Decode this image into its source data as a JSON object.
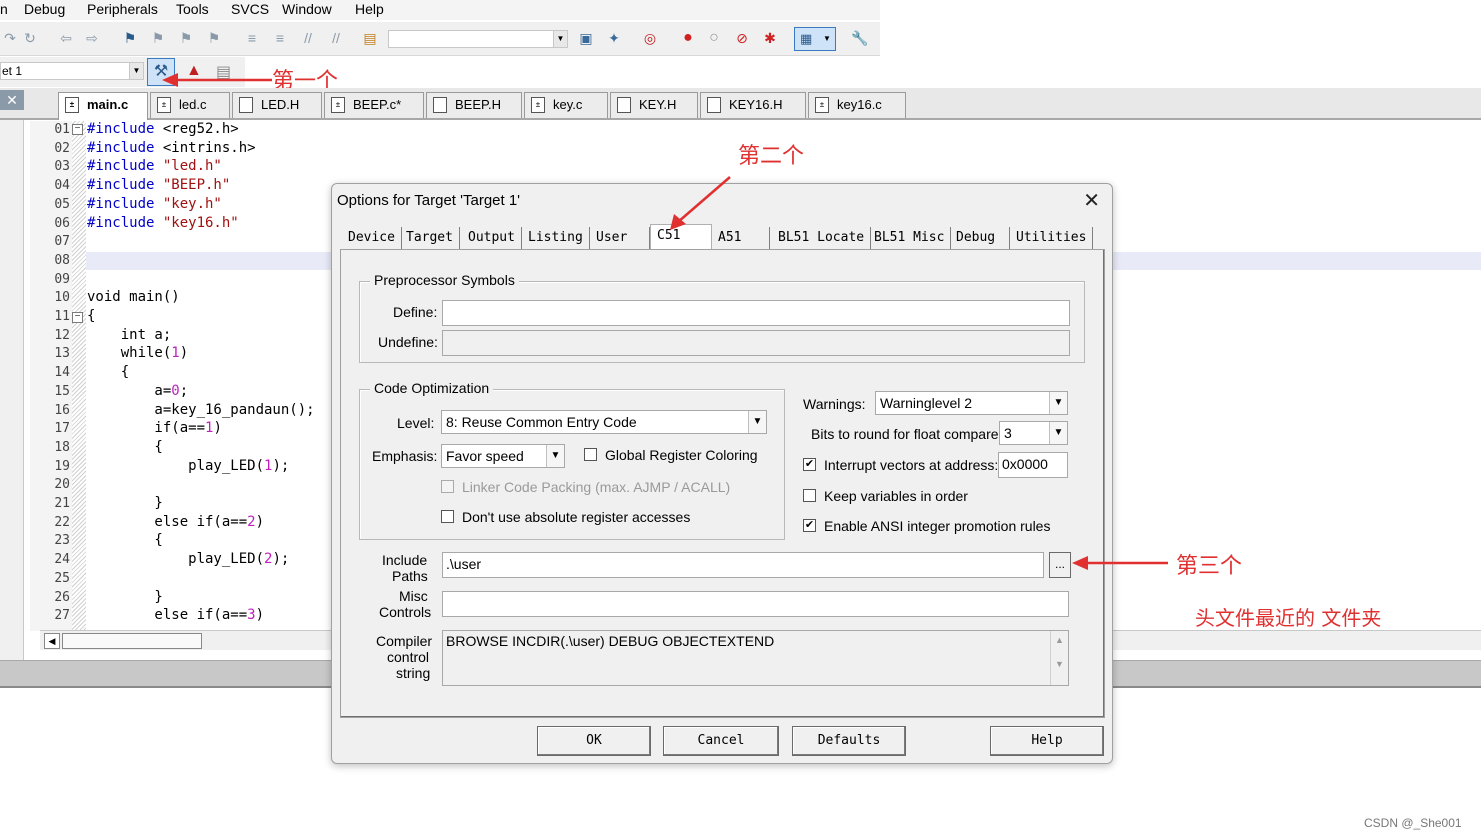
{
  "menu": [
    "n",
    "Debug",
    "Peripherals",
    "Tools",
    "SVCS",
    "Window",
    "Help"
  ],
  "target_combo": "et  1",
  "file_tabs": [
    "main.c",
    "led.c",
    "LED.H",
    "BEEP.c*",
    "BEEP.H",
    "key.c",
    "KEY.H",
    "KEY16.H",
    "key16.c"
  ],
  "close_glyph": "✕",
  "code": {
    "line_numbers": [
      "01",
      "02",
      "03",
      "04",
      "05",
      "06",
      "07",
      "08",
      "09",
      "10",
      "11",
      "12",
      "13",
      "14",
      "15",
      "16",
      "17",
      "18",
      "19",
      "20",
      "21",
      "22",
      "23",
      "24",
      "25",
      "26",
      "27"
    ],
    "lines": [
      [
        "#include ",
        "<reg52.h>"
      ],
      [
        "#include ",
        "<intrins.h>"
      ],
      [
        "#include ",
        "\"led.h\""
      ],
      [
        "#include ",
        "\"BEEP.h\""
      ],
      [
        "#include ",
        "\"key.h\""
      ],
      [
        "#include ",
        "\"key16.h\""
      ],
      [
        "",
        ""
      ],
      [
        "",
        ""
      ],
      [
        "",
        ""
      ],
      [
        "void main()",
        ""
      ],
      [
        "{",
        ""
      ],
      [
        "    int a;",
        ""
      ],
      [
        "    while(",
        "1",
        ")"
      ],
      [
        "    {",
        ""
      ],
      [
        "        a=",
        "0",
        ";"
      ],
      [
        "        a=key_16_pandaun();",
        ""
      ],
      [
        "        if(a==",
        "1",
        ")"
      ],
      [
        "        {",
        ""
      ],
      [
        "            play_LED(",
        "1",
        ");"
      ],
      [
        "",
        ""
      ],
      [
        "        }",
        ""
      ],
      [
        "        else if(a==",
        "2",
        ")"
      ],
      [
        "        {",
        ""
      ],
      [
        "            play_LED(",
        "2",
        ");"
      ],
      [
        "",
        ""
      ],
      [
        "        }",
        ""
      ],
      [
        "        else if(a==",
        "3",
        ")"
      ]
    ]
  },
  "annotations": {
    "first": "第一个",
    "second": "第二个",
    "third": "第三个",
    "note": "头文件最近的 文件夹"
  },
  "dialog": {
    "title": "Options for Target 'Target 1'",
    "close": "✕",
    "tabs": [
      "Device",
      "Target",
      "Output",
      "Listing",
      "User",
      "C51",
      "A51",
      "BL51 Locate",
      "BL51 Misc",
      "Debug",
      "Utilities"
    ],
    "active_tab": "C51",
    "preprocessor": {
      "title": "Preprocessor Symbols",
      "define_label": "Define:",
      "define_value": "",
      "undefine_label": "Undefine:",
      "undefine_value": ""
    },
    "optimization": {
      "title": "Code Optimization",
      "level_label": "Level:",
      "level_value": "8: Reuse Common Entry Code",
      "emphasis_label": "Emphasis:",
      "emphasis_value": "Favor speed",
      "global_reg": "Global Register Coloring",
      "linker_packing": "Linker Code Packing (max. AJMP / ACALL)",
      "no_abs_reg": "Don't use absolute register accesses"
    },
    "right_opts": {
      "warnings_label": "Warnings:",
      "warnings_value": "Warninglevel 2",
      "bits_label": "Bits to round for float compare:",
      "bits_value": "3",
      "interrupt_label": "Interrupt vectors at address:",
      "interrupt_value": "0x0000",
      "keep_vars": "Keep variables in order",
      "ansi_promo": "Enable ANSI integer promotion rules"
    },
    "include_label_1": "Include",
    "include_label_2": "Paths",
    "include_value": ".\\user",
    "browse": "...",
    "misc_label_1": "Misc",
    "misc_label_2": "Controls",
    "misc_value": "",
    "compiler_label_1": "Compiler",
    "compiler_label_2": "control",
    "compiler_label_3": "string",
    "compiler_value": "BROWSE INCDIR(.\\user) DEBUG OBJECTEXTEND",
    "buttons": {
      "ok": "OK",
      "cancel": "Cancel",
      "defaults": "Defaults",
      "help": "Help"
    }
  },
  "watermark": "CSDN @_She001",
  "colors": {
    "annotation": "#e03030",
    "include_directive": "#0000c8",
    "string": "#a01010",
    "number": "#c020c0"
  }
}
